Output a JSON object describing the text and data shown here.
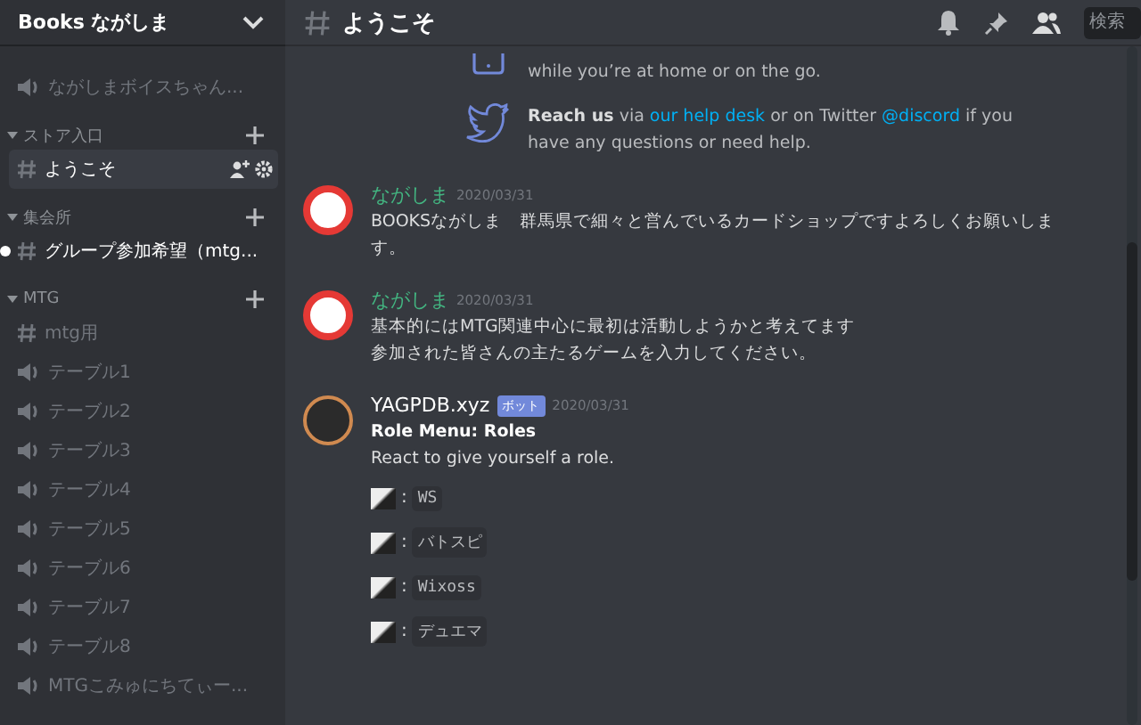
{
  "server": {
    "name": "Books ながしま"
  },
  "top_channels": [
    {
      "kind": "voice",
      "name": "ながしまボイスちゃん...",
      "selected": false,
      "unread": false
    }
  ],
  "categories": [
    {
      "name": "ストア入口",
      "expanded": true,
      "channels": [
        {
          "kind": "text",
          "name": "ようこそ",
          "selected": true,
          "unread": false
        }
      ]
    },
    {
      "name": "集会所",
      "expanded": true,
      "channels": [
        {
          "kind": "text",
          "name": "グループ参加希望（mtg...",
          "selected": false,
          "unread": true
        }
      ]
    },
    {
      "name": "MTG",
      "expanded": true,
      "channels": [
        {
          "kind": "text",
          "name": "mtg用",
          "selected": false,
          "unread": false
        },
        {
          "kind": "voice",
          "name": "テーブル1",
          "selected": false,
          "unread": false
        },
        {
          "kind": "voice",
          "name": "テーブル2",
          "selected": false,
          "unread": false
        },
        {
          "kind": "voice",
          "name": "テーブル3",
          "selected": false,
          "unread": false
        },
        {
          "kind": "voice",
          "name": "テーブル4",
          "selected": false,
          "unread": false
        },
        {
          "kind": "voice",
          "name": "テーブル5",
          "selected": false,
          "unread": false
        },
        {
          "kind": "voice",
          "name": "テーブル6",
          "selected": false,
          "unread": false
        },
        {
          "kind": "voice",
          "name": "テーブル7",
          "selected": false,
          "unread": false
        },
        {
          "kind": "voice",
          "name": "テーブル8",
          "selected": false,
          "unread": false
        },
        {
          "kind": "voice",
          "name": "MTGこみゅにちてぃー...",
          "selected": false,
          "unread": false
        }
      ]
    }
  ],
  "header": {
    "channel": "ようこそ",
    "search": {
      "placeholder": "検索"
    }
  },
  "welcome": [
    {
      "kind": "phone",
      "segments": [
        {
          "kind": "text",
          "text": "while you’re at home or on the go."
        }
      ]
    },
    {
      "kind": "bird",
      "segments": [
        {
          "kind": "bold",
          "text": "Reach us"
        },
        {
          "kind": "text",
          "text": " via "
        },
        {
          "kind": "link",
          "text": "our help desk"
        },
        {
          "kind": "text",
          "text": " or on Twitter "
        },
        {
          "kind": "link",
          "text": "@discord"
        },
        {
          "kind": "text",
          "text": " if you have any questions or need help."
        }
      ]
    }
  ],
  "messages": [
    {
      "author": "ながしま",
      "color": "#43b581",
      "kind": "user",
      "date": "2020/03/31",
      "lines": [
        "BOOKSながしま　群馬県で細々と営んでいるカードショップですよろしくお願いします。"
      ]
    },
    {
      "author": "ながしま",
      "color": "#43b581",
      "kind": "user",
      "date": "2020/03/31",
      "lines": [
        "基本的にはMTG関連中心に最初は活動しようかと考えてます",
        "参加された皆さんの主たるゲームを入力してください。"
      ]
    },
    {
      "author": "YAGPDB.xyz",
      "color": "#ffffff",
      "kind": "bot",
      "badge": "ボット",
      "date": "2020/03/31",
      "title": "Role Menu: Roles",
      "lines": [
        "React to give yourself a role."
      ],
      "roles": [
        {
          "separator": ":",
          "role": "WS"
        },
        {
          "separator": ":",
          "role": "バトスピ"
        },
        {
          "separator": ":",
          "role": "Wixoss"
        },
        {
          "separator": ":",
          "role": "デュエマ"
        }
      ]
    }
  ]
}
